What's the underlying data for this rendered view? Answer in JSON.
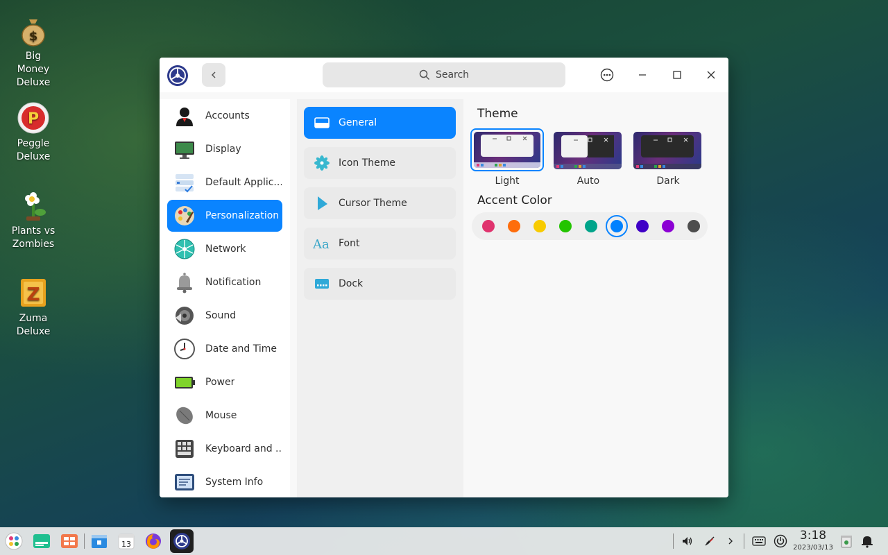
{
  "desktop": {
    "icons": [
      {
        "label": "Big Money Deluxe"
      },
      {
        "label": "Peggle Deluxe"
      },
      {
        "label": "Plants vs Zombies"
      },
      {
        "label": "Zuma Deluxe"
      }
    ]
  },
  "window": {
    "search_placeholder": "Search",
    "nav": [
      {
        "label": "Accounts",
        "icon": "account-icon"
      },
      {
        "label": "Display",
        "icon": "display-icon"
      },
      {
        "label": "Default Applic...",
        "icon": "default-apps-icon"
      },
      {
        "label": "Personalization",
        "icon": "personalization-icon",
        "active": true
      },
      {
        "label": "Network",
        "icon": "network-icon"
      },
      {
        "label": "Notification",
        "icon": "bell-icon"
      },
      {
        "label": "Sound",
        "icon": "speaker-icon"
      },
      {
        "label": "Date and Time",
        "icon": "clock-icon"
      },
      {
        "label": "Power",
        "icon": "battery-icon"
      },
      {
        "label": "Mouse",
        "icon": "mouse-icon"
      },
      {
        "label": "Keyboard and ...",
        "icon": "keyboard-icon"
      },
      {
        "label": "System Info",
        "icon": "system-info-icon"
      }
    ],
    "subnav": [
      {
        "label": "General",
        "icon": "general-icon",
        "active": true
      },
      {
        "label": "Icon Theme",
        "icon": "icon-theme-icon"
      },
      {
        "label": "Cursor Theme",
        "icon": "cursor-icon"
      },
      {
        "label": "Font",
        "icon": "font-icon"
      },
      {
        "label": "Dock",
        "icon": "dock-icon"
      }
    ],
    "theme": {
      "title": "Theme",
      "options": [
        {
          "label": "Light",
          "selected": true
        },
        {
          "label": "Auto"
        },
        {
          "label": "Dark"
        }
      ]
    },
    "accent": {
      "title": "Accent Color",
      "colors": [
        "#e0336e",
        "#fe6d0c",
        "#f8cb00",
        "#23c400",
        "#00a48a",
        "#0081ff",
        "#3f00c6",
        "#8c00d4",
        "#4d4d4d"
      ],
      "selected_index": 5
    }
  },
  "taskbar": {
    "time": "3:18",
    "date": "2023/03/13",
    "calendar_day": "13"
  },
  "colors": {
    "accent": "#0a84ff"
  }
}
